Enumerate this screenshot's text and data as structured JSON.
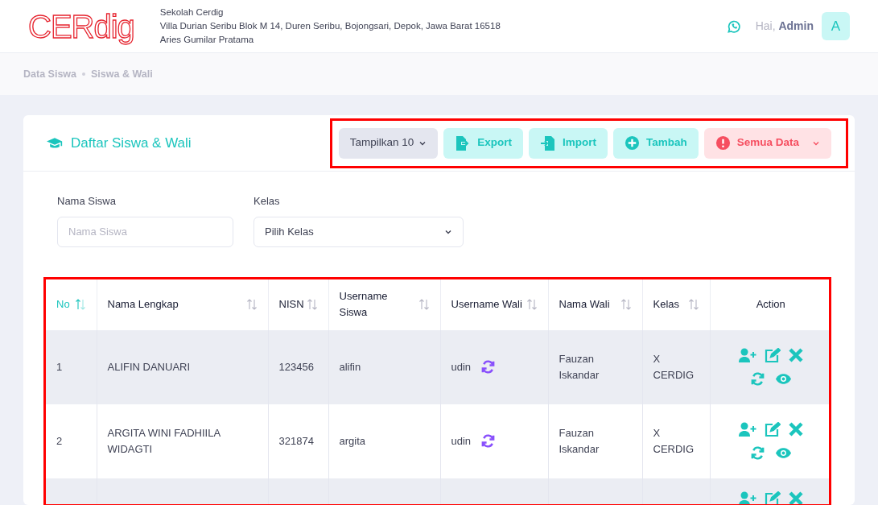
{
  "header": {
    "logo": "CERdig",
    "school_name": "Sekolah Cerdig",
    "address": "Villa Durian Seribu Blok M 14, Duren Seribu, Bojongsari, Depok, Jawa Barat 16518",
    "principal": "Aries Gumilar Pratama",
    "greeting": "Hai,",
    "user": "Admin",
    "avatar": "A"
  },
  "breadcrumb": [
    "Data Siswa",
    "Siswa & Wali"
  ],
  "card": {
    "title": "Daftar Siswa & Wali",
    "toolbar": [
      {
        "kind": "dropdown",
        "label": "Tampilkan 10"
      },
      {
        "kind": "export",
        "label": "Export"
      },
      {
        "kind": "import",
        "label": "Import"
      },
      {
        "kind": "add",
        "label": "Tambah"
      },
      {
        "kind": "filter",
        "label": "Semua Data"
      }
    ],
    "filters": [
      {
        "kind": "text",
        "label": "Nama Siswa",
        "placeholder": "Nama Siswa"
      },
      {
        "kind": "select",
        "label": "Kelas",
        "value": "Pilih Kelas"
      }
    ],
    "table": {
      "columns": [
        {
          "label": "No",
          "sortable": true,
          "sorted": true
        },
        {
          "label": "Nama Lengkap",
          "sortable": true,
          "sorted": false
        },
        {
          "label": "NISN",
          "sortable": true,
          "sorted": false
        },
        {
          "label": "Username Siswa",
          "sortable": true,
          "sorted": false
        },
        {
          "label": "Username Wali",
          "sortable": true,
          "sorted": false
        },
        {
          "label": "Nama Wali",
          "sortable": true,
          "sorted": false
        },
        {
          "label": "Kelas",
          "sortable": true,
          "sorted": false
        },
        {
          "label": "Action",
          "sortable": false,
          "sorted": false
        }
      ],
      "rows": [
        {
          "no": "1",
          "name": "ALIFIN DANUARI",
          "nisn": "123456",
          "student_username": "alifin",
          "guardian_username": "udin",
          "guardian_name": "Fauzan Iskandar",
          "class": "X CERDIG"
        },
        {
          "no": "2",
          "name": "ARGITA WINI FADHIILA WIDAGTI",
          "nisn": "321874",
          "student_username": "argita",
          "guardian_username": "udin",
          "guardian_name": "Fauzan Iskandar",
          "class": "X CERDIG"
        },
        {
          "partial": true
        }
      ]
    }
  }
}
